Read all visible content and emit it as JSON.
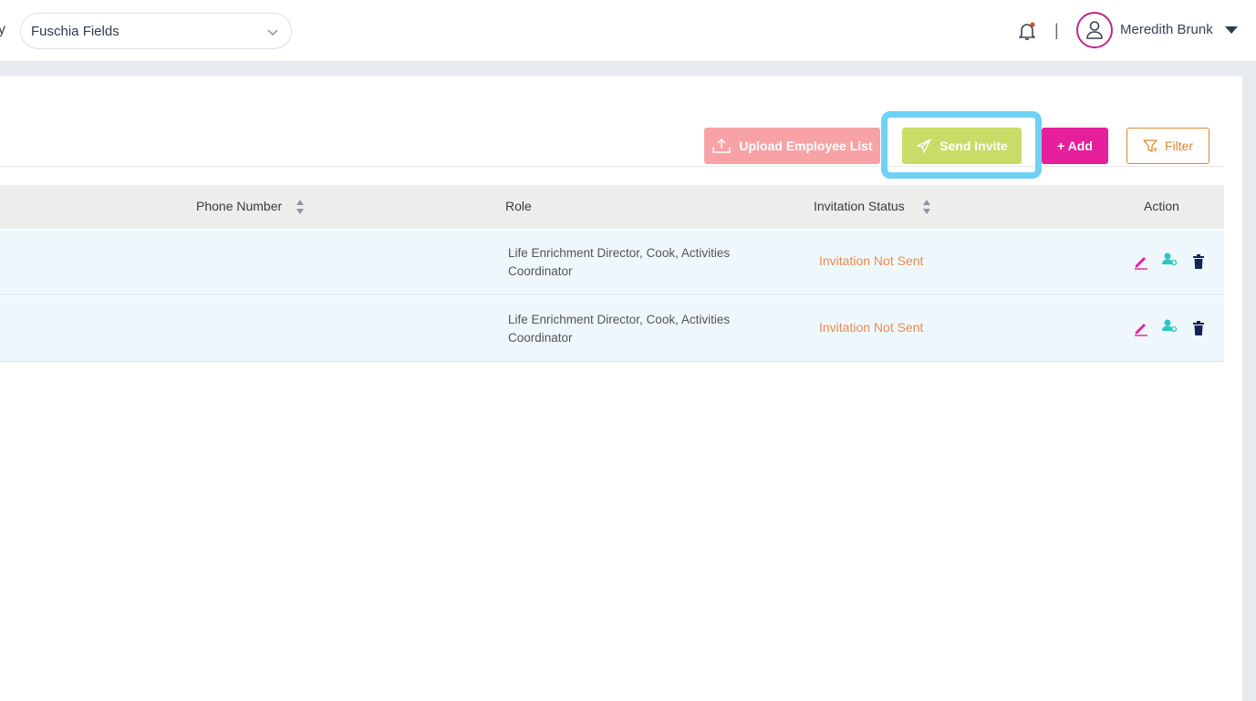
{
  "header": {
    "cut_text": "y",
    "facility_select": {
      "value": "Fuschia Fields"
    },
    "divider": "|",
    "user_name": "Meredith Brunk"
  },
  "toolbar": {
    "upload_label": "Upload Employee List",
    "send_invite_label": "Send Invite",
    "add_label": "+ Add",
    "filter_label": "Filter"
  },
  "table": {
    "headers": {
      "phone": "Phone Number",
      "role": "Role",
      "status": "Invitation Status",
      "action": "Action"
    },
    "rows": [
      {
        "role": "Life Enrichment Director, Cook, Activities Coordinator",
        "status": "Invitation Not Sent"
      },
      {
        "role": "Life Enrichment Director, Cook, Activities Coordinator",
        "status": "Invitation Not Sent"
      }
    ]
  },
  "colors": {
    "accent_pink": "#e61f9b",
    "send_green": "#c8dc67",
    "upload_salmon": "#f7a3a6",
    "filter_orange": "#e08430",
    "status_orange": "#ef8a4c",
    "highlight_blue": "#6fd2f5"
  },
  "icons": [
    "chevron-down-icon",
    "bell-icon",
    "user-icon",
    "upload-icon",
    "send-icon",
    "filter-icon",
    "sort-icon",
    "edit-icon",
    "assign-user-icon",
    "trash-icon"
  ]
}
